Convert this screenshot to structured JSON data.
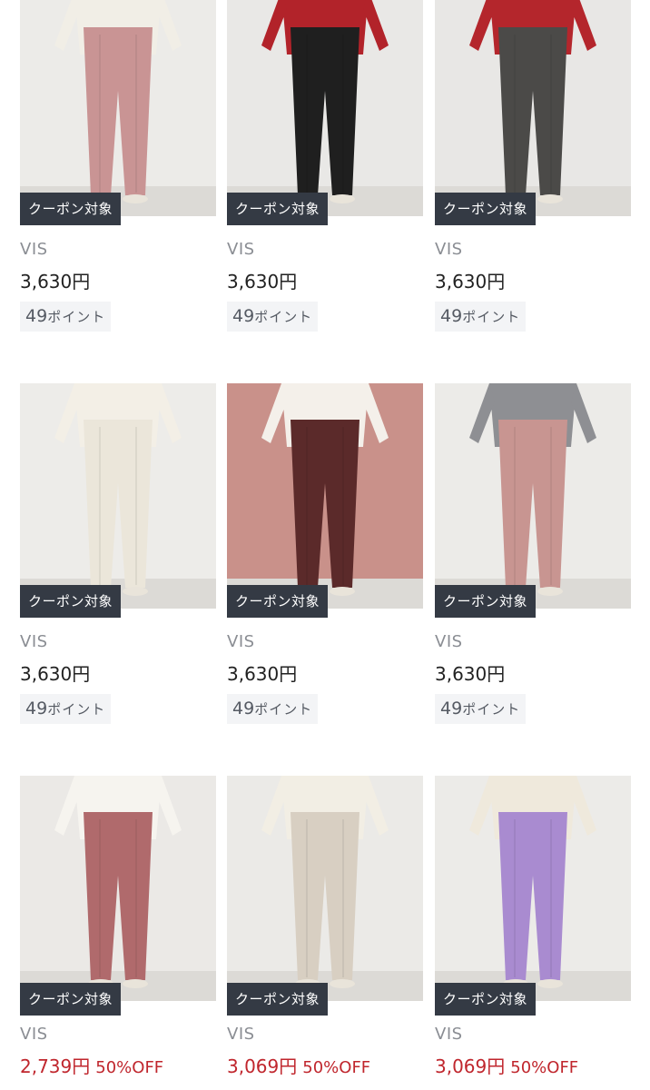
{
  "products": [
    {
      "badge": "クーポン対象",
      "brand": "VIS",
      "price": "3,630円",
      "points_value": "49",
      "points_unit": "ポイント",
      "pants_color": "#c99494",
      "top_color": "#f1eee6",
      "bg_color": "#ecebe8"
    },
    {
      "badge": "クーポン対象",
      "brand": "VIS",
      "price": "3,630円",
      "points_value": "49",
      "points_unit": "ポイント",
      "pants_color": "#1f1f1f",
      "top_color": "#b2232a",
      "bg_color": "#e9e8e6"
    },
    {
      "badge": "クーポン対象",
      "brand": "VIS",
      "price": "3,630円",
      "points_value": "49",
      "points_unit": "ポイント",
      "pants_color": "#4b4a48",
      "top_color": "#b4262c",
      "bg_color": "#e8e7e5"
    },
    {
      "badge": "クーポン対象",
      "brand": "VIS",
      "price": "3,630円",
      "points_value": "49",
      "points_unit": "ポイント",
      "pants_color": "#ebe6da",
      "top_color": "#f3efe6",
      "bg_color": "#edece9"
    },
    {
      "badge": "クーポン対象",
      "brand": "VIS",
      "price": "3,630円",
      "points_value": "49",
      "points_unit": "ポイント",
      "pants_color": "#5b2a2a",
      "top_color": "#f4f0ea",
      "bg_color": "#c9918a"
    },
    {
      "badge": "クーポン対象",
      "brand": "VIS",
      "price": "3,630円",
      "points_value": "49",
      "points_unit": "ポイント",
      "pants_color": "#c89591",
      "top_color": "#8e8f93",
      "bg_color": "#ecebe8"
    },
    {
      "badge": "クーポン対象",
      "brand": "VIS",
      "price": "2,739円",
      "discount": "50%OFF",
      "pants_color": "#b06a6c",
      "top_color": "#f6f4ef",
      "bg_color": "#ebe9e6"
    },
    {
      "badge": "クーポン対象",
      "brand": "VIS",
      "price": "3,069円",
      "discount": "50%OFF",
      "pants_color": "#d8cfc2",
      "top_color": "#f2eee4",
      "bg_color": "#ebeae7"
    },
    {
      "badge": "クーポン対象",
      "brand": "VIS",
      "price": "3,069円",
      "discount": "50%OFF",
      "pants_color": "#a98bd0",
      "top_color": "#efe9dc",
      "bg_color": "#ecebe8"
    }
  ]
}
